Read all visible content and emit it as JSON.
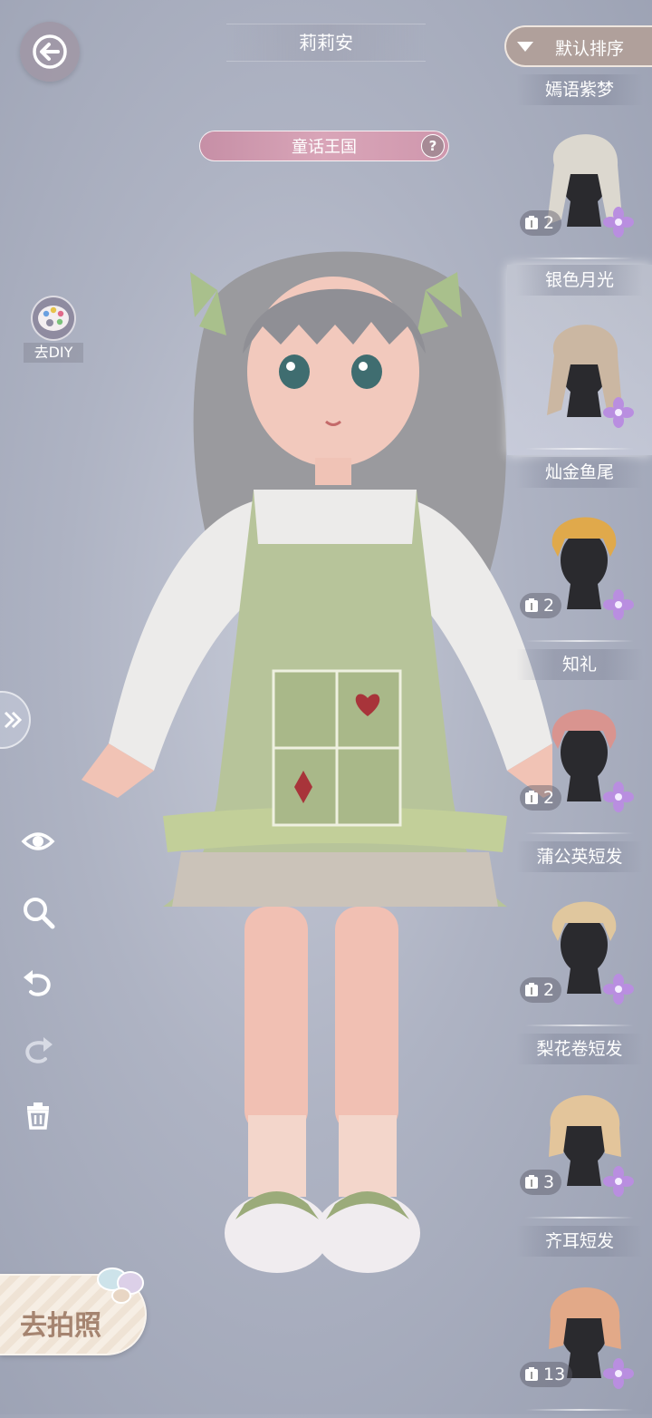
{
  "header": {
    "title": "莉莉安"
  },
  "theme": {
    "label": "童话王国",
    "help_glyph": "?"
  },
  "diy": {
    "label": "去DIY"
  },
  "sort": {
    "label": "默认排序"
  },
  "photo": {
    "label": "去拍照"
  },
  "hair_items": [
    {
      "name": "嫣语紫梦",
      "count": "2",
      "color": "#dcd8cf",
      "style": "long-braid"
    },
    {
      "name": "银色月光",
      "count": "",
      "color": "#cbb7a2",
      "style": "long-wavy"
    },
    {
      "name": "灿金鱼尾",
      "count": "2",
      "color": "#e0a94b",
      "style": "short"
    },
    {
      "name": "知礼",
      "count": "2",
      "color": "#d9948f",
      "style": "short"
    },
    {
      "name": "蒲公英短发",
      "count": "2",
      "color": "#e0c79e",
      "style": "short"
    },
    {
      "name": "梨花卷短发",
      "count": "3",
      "color": "#e3c59b",
      "style": "bob"
    },
    {
      "name": "齐耳短发",
      "count": "13",
      "color": "#e2a988",
      "style": "bob"
    }
  ],
  "colors": {
    "accent_pink": "#d9a5b8",
    "flower_purple": "#b98ee0",
    "sort_bg": "#b0a09b"
  },
  "icons": [
    "back-arrow-icon",
    "help-icon",
    "palette-icon",
    "expand-icon",
    "eye-icon",
    "zoom-icon",
    "undo-icon",
    "redo-icon",
    "trash-icon",
    "flower-icon",
    "closet-icon",
    "sort-down-icon"
  ]
}
